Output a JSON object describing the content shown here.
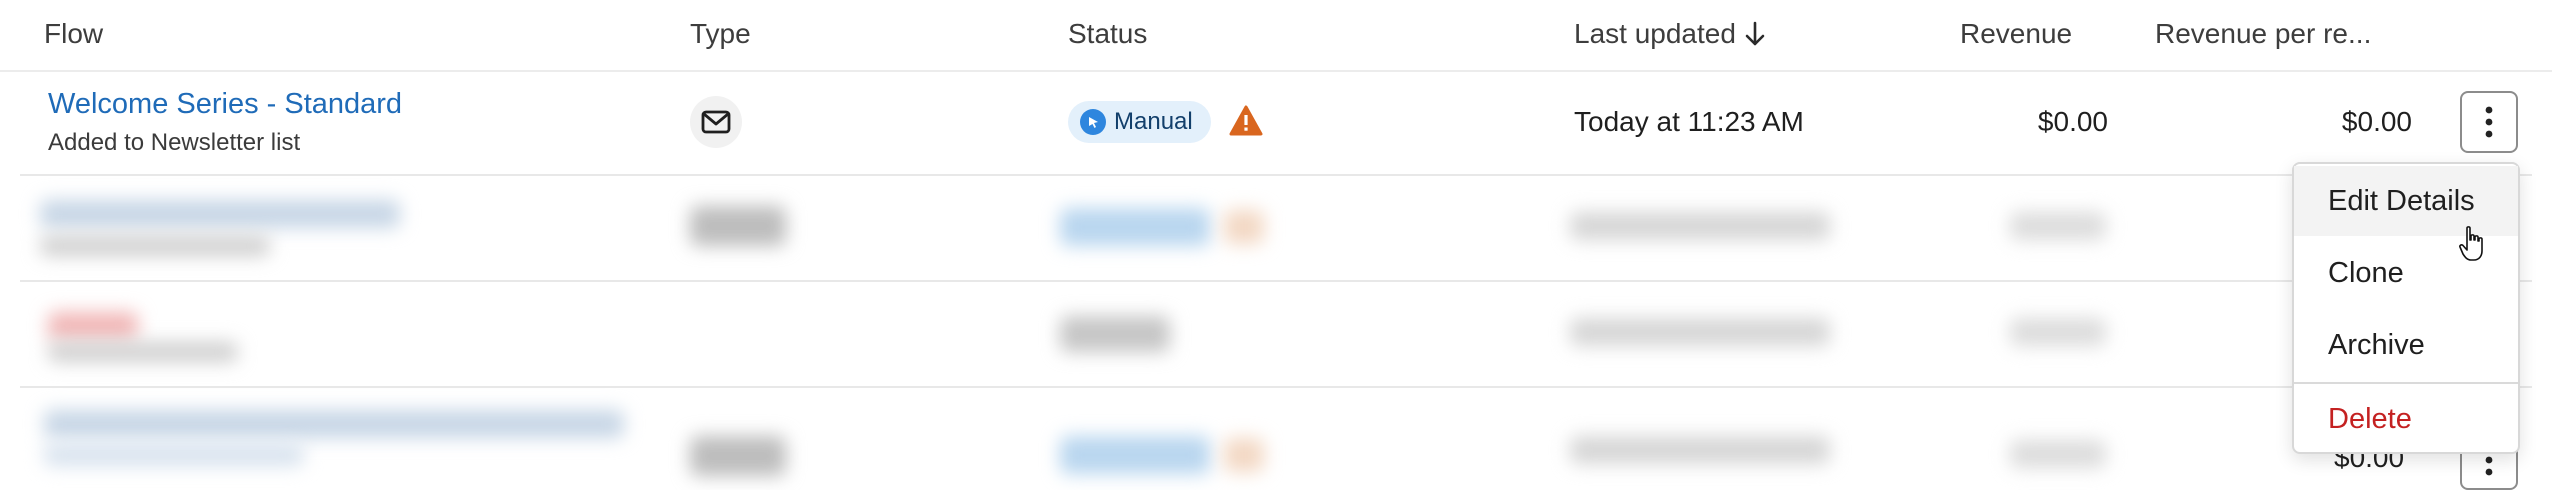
{
  "table": {
    "columns": {
      "flow": "Flow",
      "type": "Type",
      "status": "Status",
      "last_updated": "Last updated",
      "revenue": "Revenue",
      "revenue_per_recipient": "Revenue per re..."
    },
    "sort_icon": "arrow-down-icon",
    "rows": [
      {
        "name": "Welcome Series - Standard",
        "trigger": "Added to Newsletter list",
        "type_icon": "envelope-icon",
        "status": "Manual",
        "status_icon": "cursor-click-icon",
        "warning_icon": "warning-triangle-icon",
        "last_updated": "Today at 11:23 AM",
        "revenue": "$0.00",
        "revenue_per_recipient": "$0.00"
      }
    ],
    "partial_row": {
      "revenue_per_recipient": "$0.00"
    }
  },
  "menu": {
    "items": [
      "Edit Details",
      "Clone",
      "Archive",
      "Delete"
    ]
  },
  "colors": {
    "link": "#1f6bb8",
    "status_badge_bg": "#e3f0fb",
    "status_badge_icon": "#2e86de",
    "warning": "#d9661f",
    "danger": "#c42121"
  }
}
